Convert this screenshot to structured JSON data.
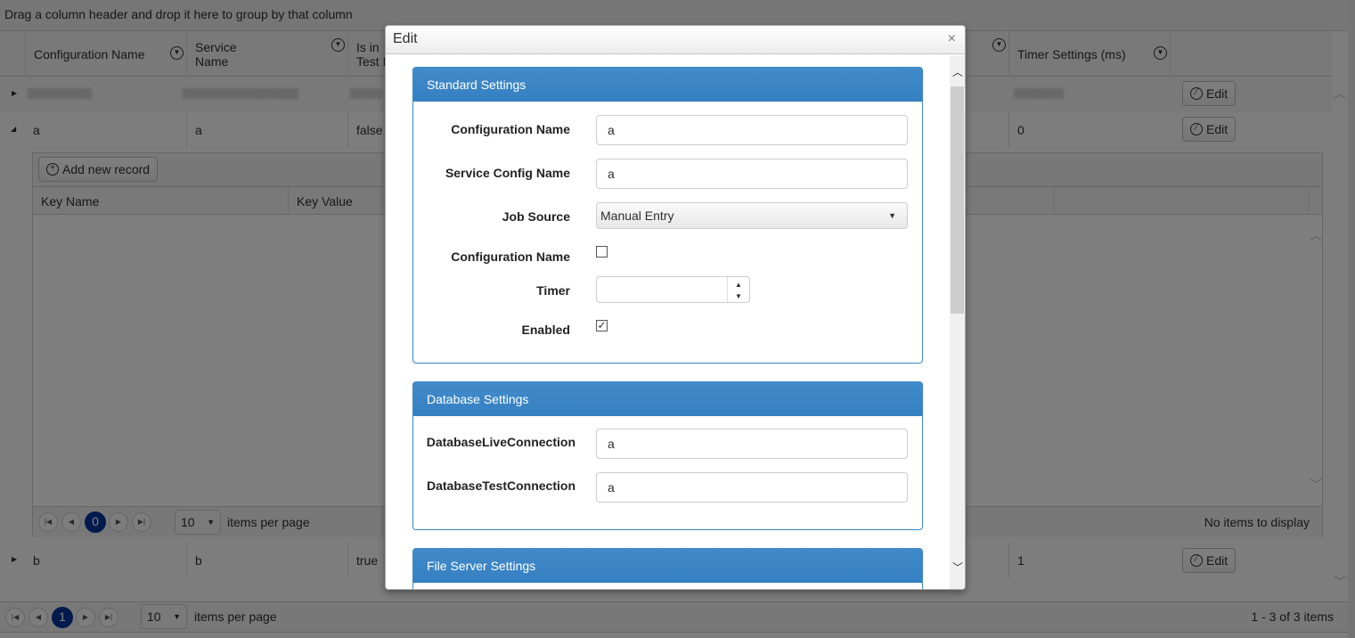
{
  "grid": {
    "group_hint": "Drag a column header and drop it here to group by that column",
    "columns": [
      "Configuration Name",
      "Service\nName",
      "Is in\nTest Mode",
      "Timer Settings (ms)"
    ],
    "col_service_1": "Service",
    "col_service_2": "Name",
    "col_test_1": "Is in",
    "col_test_2": "Test I",
    "rows": [
      {
        "config": "a",
        "service": "a",
        "test": "false",
        "timer": "0",
        "edit": "Edit"
      },
      {
        "config": "b",
        "service": "b",
        "test": "true",
        "timer": "1",
        "edit": "Edit"
      }
    ],
    "blurred_edit": "Edit",
    "detail": {
      "add_label": "Add new record",
      "columns": [
        "Key Name",
        "Key Value"
      ],
      "page": "0",
      "page_size": "10",
      "items_per_page": "items per page",
      "status": "No items to display"
    },
    "pager": {
      "page": "1",
      "page_size": "10",
      "items_per_page": "items per page",
      "status": "1 - 3 of 3 items"
    }
  },
  "modal": {
    "title": "Edit",
    "close": "×",
    "standard": {
      "title": "Standard Settings",
      "config_name_label": "Configuration Name",
      "config_name_value": "a",
      "service_config_label": "Service Config Name",
      "service_config_value": "a",
      "job_source_label": "Job Source",
      "job_source_value": "Manual Entry",
      "config_name2_label": "Configuration Name",
      "config_name2_checked": false,
      "timer_label": "Timer",
      "timer_value": "",
      "enabled_label": "Enabled",
      "enabled_checked": true
    },
    "database": {
      "title": "Database Settings",
      "live_label": "DatabaseLiveConnection",
      "live_value": "a",
      "test_label": "DatabaseTestConnection",
      "test_value": "a"
    },
    "fileserver": {
      "title": "File Server Settings"
    }
  },
  "colors": {
    "accent": "#3a87c8",
    "pager_current": "#00349a",
    "overlay": "rgba(0,0,0,0.5)"
  }
}
